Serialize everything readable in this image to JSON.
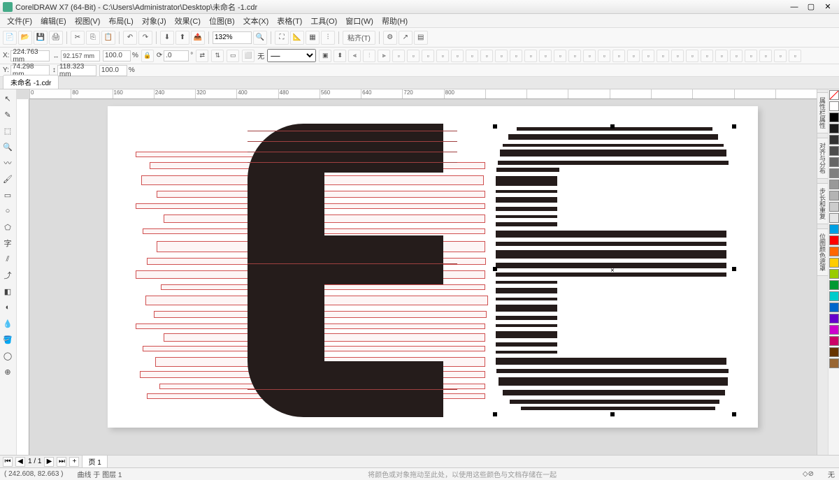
{
  "titlebar": {
    "title": "CorelDRAW X7 (64-Bit) - C:\\Users\\Administrator\\Desktop\\未命名 -1.cdr"
  },
  "menu": {
    "file": "文件(F)",
    "edit": "编辑(E)",
    "view": "视图(V)",
    "layout": "布局(L)",
    "object": "对象(J)",
    "effect": "效果(C)",
    "bitmap": "位图(B)",
    "text": "文本(X)",
    "table": "表格(T)",
    "tool": "工具(O)",
    "window": "窗口(W)",
    "help": "帮助(H)"
  },
  "toolbar": {
    "zoom": "132%",
    "snap": "粘齐(T)"
  },
  "property": {
    "x_label": "X:",
    "x": "224.763 mm",
    "y_label": "Y:",
    "y": "74.298 mm",
    "w_prefix": "↔",
    "w": "92.157 mm",
    "h_prefix": "↕",
    "h": "118.323 mm",
    "sx": "100.0",
    "sy": "100.0",
    "pct": "%",
    "rot": ".0",
    "deg": "°",
    "fill": "无",
    "fill_lbl": "⬜"
  },
  "tabs": {
    "doc": "未命名 -1.cdr"
  },
  "dockers": {
    "t1": "属性栏属性",
    "t2": "对齐与分布",
    "t3": "步长和重复",
    "t4": "位图颜色遮罩"
  },
  "pager": {
    "count": "1 / 1",
    "page": "页 1"
  },
  "status": {
    "coords": "( 242.608, 82.663 )",
    "obj": "曲线 于 图层 1",
    "hint": "将颜色或对象拖动至此处，以使用这些颜色与文档存储在一起",
    "fill": "无"
  },
  "ruler_ticks": [
    "0",
    "80",
    "160",
    "240",
    "320",
    "400",
    "480",
    "560",
    "640",
    "720",
    "800",
    "",
    "",
    "",
    "",
    "",
    "",
    "",
    ""
  ],
  "colors": [
    "#ffffff",
    "#000000",
    "#1a1a1a",
    "#333333",
    "#4d4d4d",
    "#666666",
    "#808080",
    "#999999",
    "#b3b3b3",
    "#cccccc",
    "#e6e6e6",
    "#00a0e3",
    "#ff0000",
    "#ff6600",
    "#ffcc00",
    "#99cc00",
    "#009933",
    "#00cccc",
    "#0066cc",
    "#6600cc",
    "#cc00cc",
    "#cc0066",
    "#663300",
    "#996633"
  ]
}
